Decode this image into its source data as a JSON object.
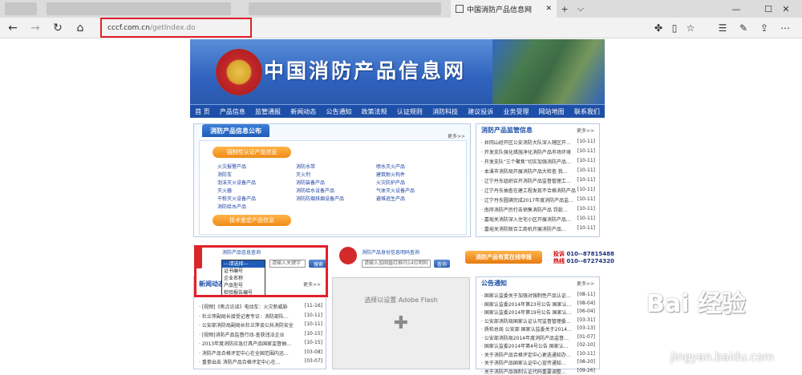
{
  "browser": {
    "active_tab_title": "中国消防产品信息网",
    "url_domain": "cccf.com.cn",
    "url_path": "/getIndex.do"
  },
  "site": {
    "title": "中国消防产品信息网",
    "nav": [
      "首 页",
      "产品信息",
      "监管通报",
      "新闻动态",
      "公告通知",
      "政策法规",
      "认证规则",
      "消防科技",
      "建议投诉",
      "业务受理",
      "网站地图",
      "联系我们"
    ],
    "announce": {
      "tab": "消防产品信息公布",
      "more": "更多>>",
      "cert_header": "强制性认证产品信息",
      "tech_header": "技术鉴定产品信息",
      "col1": [
        "火灾报警产品",
        "消防车",
        "泡沫灭火设备产品",
        "灭火器",
        "干粉灭火设备产品",
        "消防给水产品"
      ],
      "col2": [
        "消防水带",
        "灭火剂",
        "消防装备产品",
        "消防给水设备产品",
        "消防防烟排烟设备产品"
      ],
      "col3": [
        "喷水灭火产品",
        "建筑耐火构件",
        "火灾防护产品",
        "气体灭火设备产品",
        "避难逃生产品"
      ]
    },
    "supervision": {
      "title": "消防产品监管信息",
      "more": "更多>>",
      "items": [
        {
          "text": "井冈山经开区公安消防大队深入辖区开…",
          "date": "[10-11]"
        },
        {
          "text": "开发支队强化措施净化消防产品市场环境",
          "date": "[10-11]"
        },
        {
          "text": "开发支队“三个聚焦”切实加强消防产品…",
          "date": "[10-11]"
        },
        {
          "text": "本溪市消防局开展消防产品大检查 我…",
          "date": "[10-11]"
        },
        {
          "text": "辽宁丹东组织召开消防产品监督管理工…",
          "date": "[10-11]"
        },
        {
          "text": "辽宁丹东抽查在建工程发现不合格消防产品",
          "date": "[10-11]"
        },
        {
          "text": "辽宁丹东圆满完成2017年度消防产品监…",
          "date": "[10-11]"
        },
        {
          "text": "南岸消防严厉打击销售消防产品 罚款…",
          "date": "[10-11]"
        },
        {
          "text": "嘉峪关消防深入住宅小区开展消防产品…",
          "date": "[10-11]"
        },
        {
          "text": "嘉峪关消防联合工商机开展消防产品…",
          "date": "[10-11]"
        }
      ]
    },
    "query": {
      "title": "消防产品信息查询",
      "select_options": [
        "---请选择---",
        "证书编号",
        "企业名称",
        "产品型号",
        "检验报告编号"
      ],
      "input_placeholder": "请输入关键字",
      "button": "搜索"
    },
    "id_query": {
      "title": "消防产品身份信息明码查询",
      "input_placeholder": "请输入加固盾红框内14位明码",
      "button": "查询"
    },
    "report": {
      "label": "消防产品有奖在线举报",
      "tousu_label": "投诉",
      "tousu_num": "010--87815488",
      "hotline_label": "热线",
      "hotline_num": "010--67274320"
    },
    "news": {
      "title": "新闻动态",
      "more": "更多>>",
      "items": [
        {
          "text": "[视频]《焦点访谈》电动车：火灾新威胁",
          "date": "[11-16]"
        },
        {
          "text": "杜兰萍副局长接受记者专访：消防部队…",
          "date": "[10-11]"
        },
        {
          "text": "公安部消防局副局长杜兰萍谈公共消防安全",
          "date": "[10-11]"
        },
        {
          "text": "[视频]消防产品监督行动-查获违法企业",
          "date": "[10-15]"
        },
        {
          "text": "2013年度消防应急灯具产品国家监督抽…",
          "date": "[10-15]"
        },
        {
          "text": "消防产品合格评定中心在全国范围内迅…",
          "date": "[03-08]"
        },
        {
          "text": "重拳出击 消防产品合格评定中心在…",
          "date": "[03-07]"
        }
      ]
    },
    "flash_text": "选择以设置 Adobe Flash",
    "notice": {
      "title": "公告通知",
      "more": "更多>>",
      "items": [
        {
          "text": "国家认监委关于加强对强制性产品认证…",
          "date": "[08-11]"
        },
        {
          "text": "国家认监委2014年第23号公告 国家认…",
          "date": "[08-04]"
        },
        {
          "text": "国家认监委2014年第19号公告 国家认…",
          "date": "[06-04]"
        },
        {
          "text": "公安部消防局国家认证认可监督管理委…",
          "date": "[03-31]"
        },
        {
          "text": "质检总局 公安部 国家认监委关于2014…",
          "date": "[03-13]"
        },
        {
          "text": "公安部消防局2014年度消防产品监督…",
          "date": "[01-07]"
        },
        {
          "text": "国家认监委2014年第4号公告 国家认…",
          "date": "[02-10]"
        },
        {
          "text": "关于消防产品合格评定中心更迭通知办…",
          "date": "[10-11]"
        },
        {
          "text": "关于消防产品国家认证中心宣传通知…",
          "date": "[08-20]"
        },
        {
          "text": "关于消防产品强制认证代码重要调整…",
          "date": "[09-26]"
        }
      ]
    }
  },
  "watermark": {
    "logo": "Bai 经验",
    "url": "jingyan.baidu.com"
  }
}
